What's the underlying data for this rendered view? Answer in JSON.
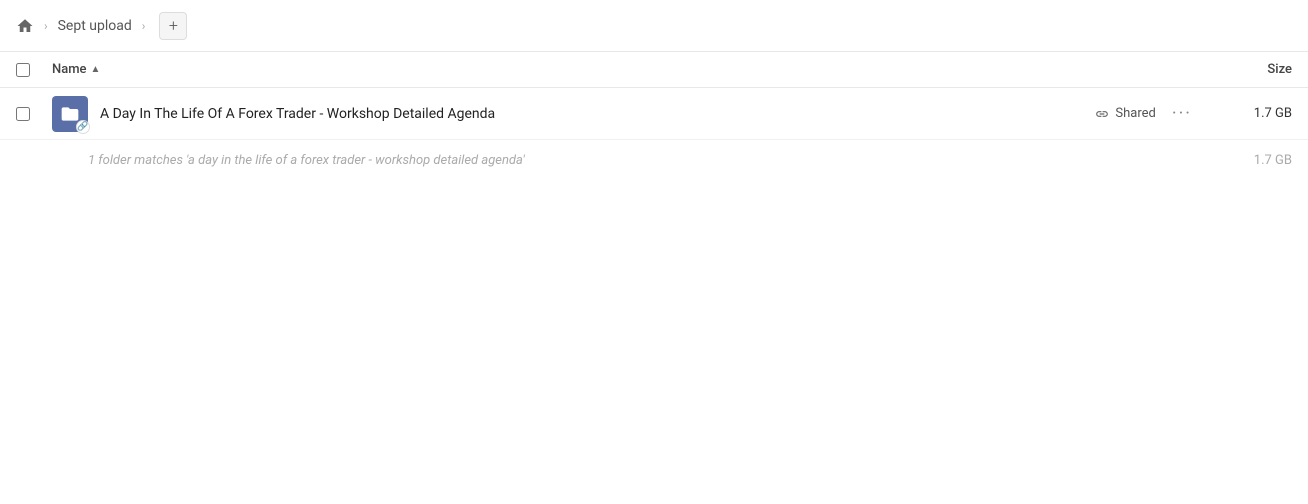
{
  "header": {
    "home_icon": "home",
    "breadcrumb": [
      {
        "label": "Sept upload",
        "id": "sept-upload"
      }
    ],
    "add_button_label": "+"
  },
  "columns": {
    "name_label": "Name",
    "size_label": "Size"
  },
  "files": [
    {
      "id": "file-1",
      "name": "A Day In The Life Of A Forex Trader - Workshop Detailed Agenda",
      "shared_label": "Shared",
      "size": "1.7 GB",
      "type": "folder-shared"
    }
  ],
  "summary": {
    "text": "1 folder matches 'a day in the life of a forex trader - workshop detailed agenda'",
    "size": "1.7 GB"
  }
}
